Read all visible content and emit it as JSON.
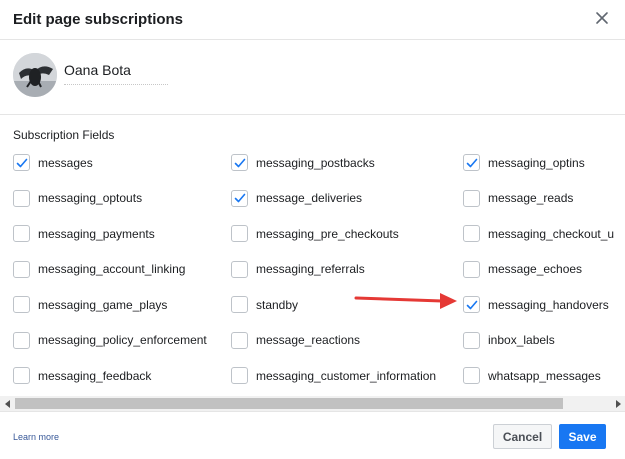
{
  "dialog": {
    "title": "Edit page subscriptions"
  },
  "page": {
    "name": "Oana Bota"
  },
  "fields": {
    "label": "Subscription Fields",
    "items": [
      {
        "label": "messages",
        "checked": true
      },
      {
        "label": "messaging_postbacks",
        "checked": true
      },
      {
        "label": "messaging_optins",
        "checked": true
      },
      {
        "label": "messaging_optouts",
        "checked": false
      },
      {
        "label": "message_deliveries",
        "checked": true
      },
      {
        "label": "message_reads",
        "checked": false
      },
      {
        "label": "messaging_payments",
        "checked": false
      },
      {
        "label": "messaging_pre_checkouts",
        "checked": false
      },
      {
        "label": "messaging_checkout_u",
        "checked": false
      },
      {
        "label": "messaging_account_linking",
        "checked": false
      },
      {
        "label": "messaging_referrals",
        "checked": false
      },
      {
        "label": "message_echoes",
        "checked": false
      },
      {
        "label": "messaging_game_plays",
        "checked": false
      },
      {
        "label": "standby",
        "checked": false
      },
      {
        "label": "messaging_handovers",
        "checked": true
      },
      {
        "label": "messaging_policy_enforcement",
        "checked": false
      },
      {
        "label": "message_reactions",
        "checked": false
      },
      {
        "label": "inbox_labels",
        "checked": false
      },
      {
        "label": "messaging_feedback",
        "checked": false
      },
      {
        "label": "messaging_customer_information",
        "checked": false
      },
      {
        "label": "whatsapp_messages",
        "checked": false
      }
    ]
  },
  "footer": {
    "learn_more": "Learn more",
    "cancel_label": "Cancel",
    "save_label": "Save"
  },
  "colors": {
    "accent": "#1877f2",
    "check": "#1877f2",
    "annotation_arrow": "#e53935"
  },
  "icons": {
    "close": "close-icon",
    "check": "checkmark-icon",
    "scroll_left": "scroll-left-arrow-icon",
    "scroll_right": "scroll-right-arrow-icon"
  }
}
